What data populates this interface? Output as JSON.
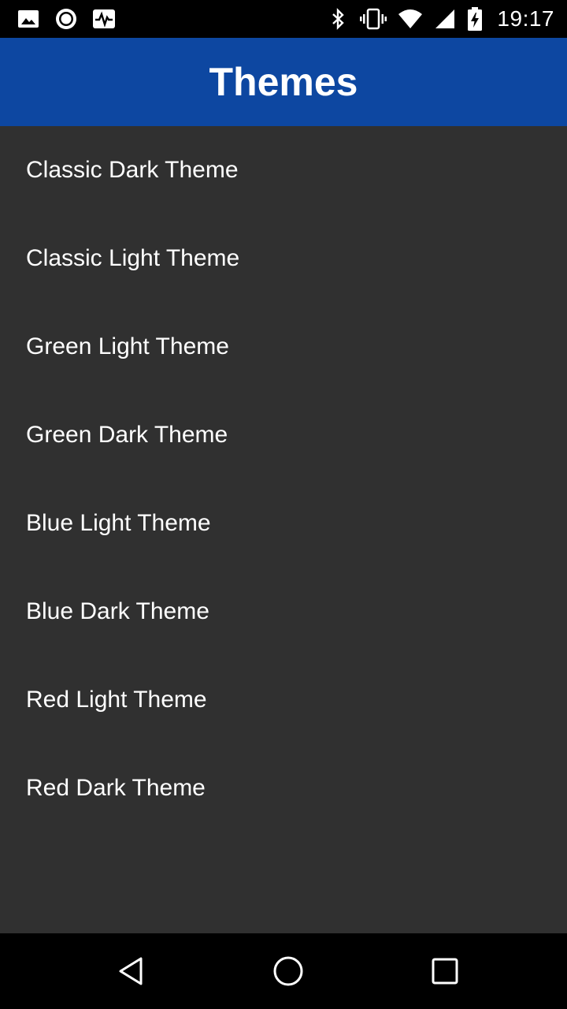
{
  "status_bar": {
    "time": "19:17",
    "left_icons": [
      "image-icon",
      "record-icon",
      "activity-icon"
    ],
    "right_icons": [
      "bluetooth-icon",
      "vibrate-icon",
      "wifi-icon",
      "signal-icon",
      "battery-charging-icon"
    ]
  },
  "app_bar": {
    "title": "Themes",
    "color": "#0d47a1"
  },
  "themes": [
    {
      "label": "Classic Dark Theme"
    },
    {
      "label": "Classic Light Theme"
    },
    {
      "label": "Green Light Theme"
    },
    {
      "label": "Green Dark Theme"
    },
    {
      "label": "Blue Light Theme"
    },
    {
      "label": "Blue Dark Theme"
    },
    {
      "label": "Red Light Theme"
    },
    {
      "label": "Red Dark Theme"
    }
  ],
  "nav_bar": {
    "buttons": [
      "back-icon",
      "home-icon",
      "recents-icon"
    ]
  },
  "colors": {
    "background": "#303030",
    "status_bar": "#000000",
    "text": "#ffffff"
  }
}
